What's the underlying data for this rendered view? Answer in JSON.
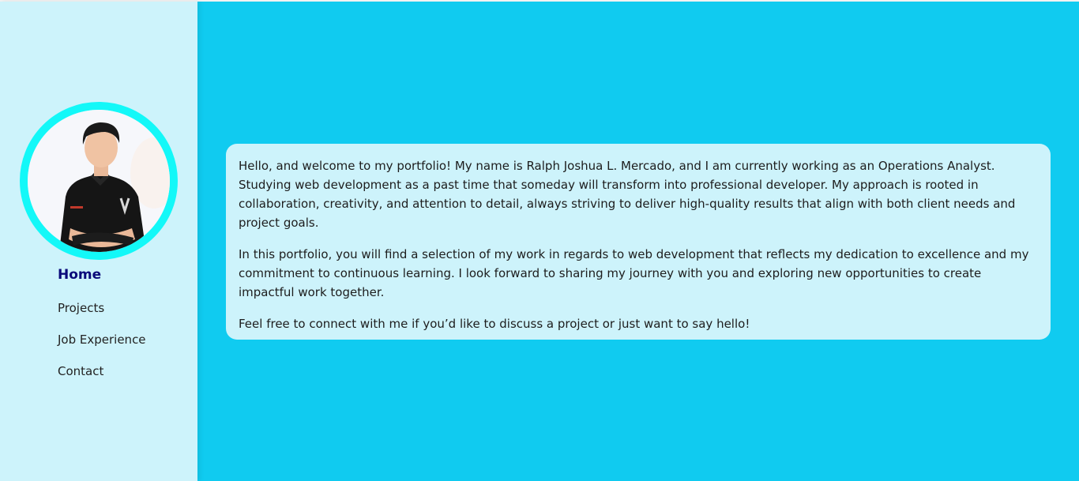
{
  "profile": {
    "photo_alt": "Ralph Joshua L. Mercado profile photo"
  },
  "nav": {
    "items": [
      {
        "label": "Home",
        "active": true
      },
      {
        "label": "Projects",
        "active": false
      },
      {
        "label": "Job Experience",
        "active": false
      },
      {
        "label": "Contact",
        "active": false
      }
    ]
  },
  "intro": {
    "paragraphs": [
      "Hello, and welcome to my portfolio! My name is Ralph Joshua L. Mercado, and I am currently working as an Operations Analyst. Studying web development as a past time that someday will transform into professional developer. My approach is rooted in collaboration, creativity, and attention to detail, always striving to deliver high-quality results that align with both client needs and project goals.",
      "In this portfolio, you will find a selection of my work in regards to web development that reflects my dedication to excellence and my commitment to continuous learning. I look forward to sharing my journey with you and exploring new opportunities to create impactful work together.",
      "Feel free to connect with me if you’d like to discuss a project or just want to say hello!"
    ]
  },
  "colors": {
    "main_bg": "#10cbf0",
    "sidebar_bg": "#cdf3fb",
    "avatar_ring": "#13f8f8",
    "nav_active": "#0a0a7a"
  }
}
